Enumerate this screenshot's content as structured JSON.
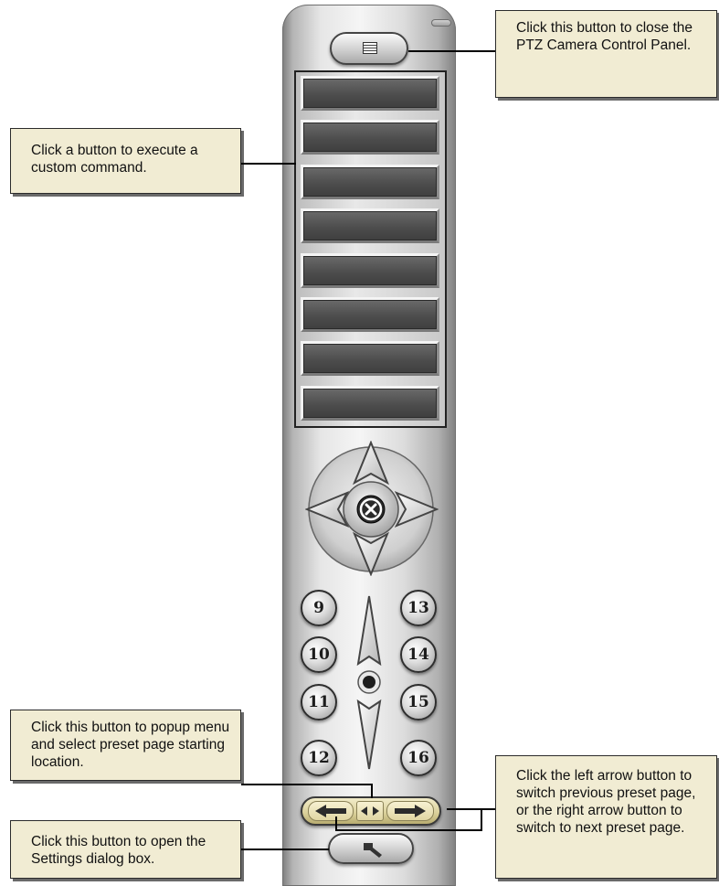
{
  "callouts": {
    "close_panel": "Click this button to close the PTZ Camera Control Panel.",
    "custom_command": "Click a button to execute a custom command.",
    "preset_page_menu": "Click this button to popup menu and select preset page starting location.",
    "settings": "Click this button to open the Settings dialog box.",
    "arrows": "Click the left arrow button to switch previous preset page, or the right arrow button to switch to next preset page."
  },
  "panel": {
    "command_buttons": [
      "",
      "",
      "",
      "",
      "",
      "",
      "",
      ""
    ],
    "presets_left": [
      "9",
      "10",
      "11",
      "12"
    ],
    "presets_right": [
      "13",
      "14",
      "15",
      "16"
    ]
  },
  "icons": {
    "close": "panel-close-icon",
    "stop": "x-stop-icon",
    "settings": "wrench-icon",
    "prev": "arrow-left-icon",
    "next": "arrow-right-icon",
    "menu": "double-arrow-icon"
  },
  "colors": {
    "callout_bg": "#f1ecd3",
    "page_bar": "#d9cf98",
    "cmd_button": "#4b4b4b"
  }
}
